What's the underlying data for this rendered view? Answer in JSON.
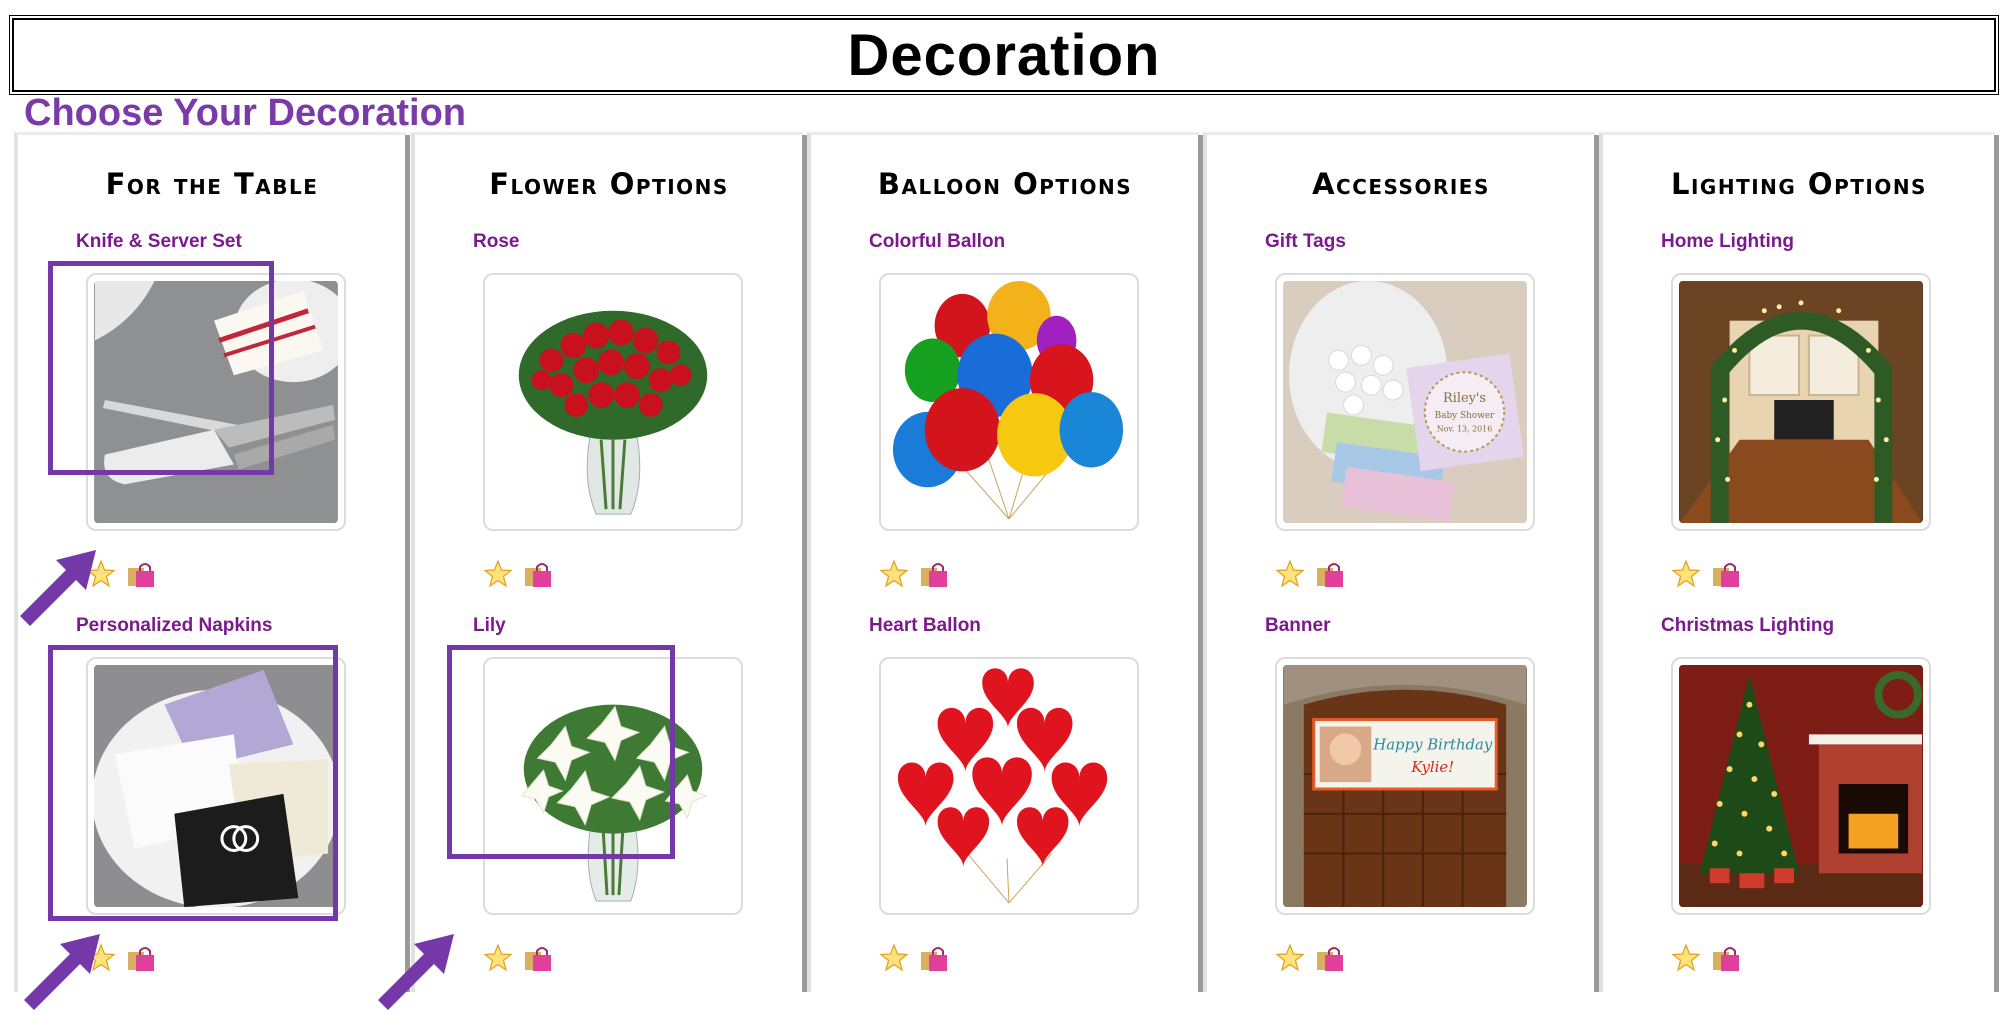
{
  "page": {
    "title": "Decoration",
    "subtitle": "Choose Your Decoration"
  },
  "columns": [
    {
      "heading": "For the Table",
      "items": [
        {
          "title": "Knife & Server Set"
        },
        {
          "title": "Personalized Napkins"
        }
      ]
    },
    {
      "heading": "Flower Options",
      "items": [
        {
          "title": "Rose"
        },
        {
          "title": "Lily"
        }
      ]
    },
    {
      "heading": "Balloon Options",
      "items": [
        {
          "title": "Colorful Ballon"
        },
        {
          "title": "Heart Ballon"
        }
      ]
    },
    {
      "heading": "Accessories",
      "items": [
        {
          "title": "Gift Tags",
          "tag_name": "Riley's",
          "tag_event": "Baby Shower",
          "tag_date": "Nov. 13, 2016"
        },
        {
          "title": "Banner",
          "banner_text": "Happy Birthday",
          "banner_name": "Kylie!"
        }
      ]
    },
    {
      "heading": "Lighting Options",
      "items": [
        {
          "title": "Home Lighting"
        },
        {
          "title": "Christmas Lighting"
        }
      ]
    }
  ],
  "icons": {
    "favorite": "star-icon",
    "cart": "shopping-bag-icon"
  },
  "colors": {
    "accent": "#7438a8",
    "item_title": "#7b1a8c",
    "subtitle": "#7a3aa8"
  }
}
